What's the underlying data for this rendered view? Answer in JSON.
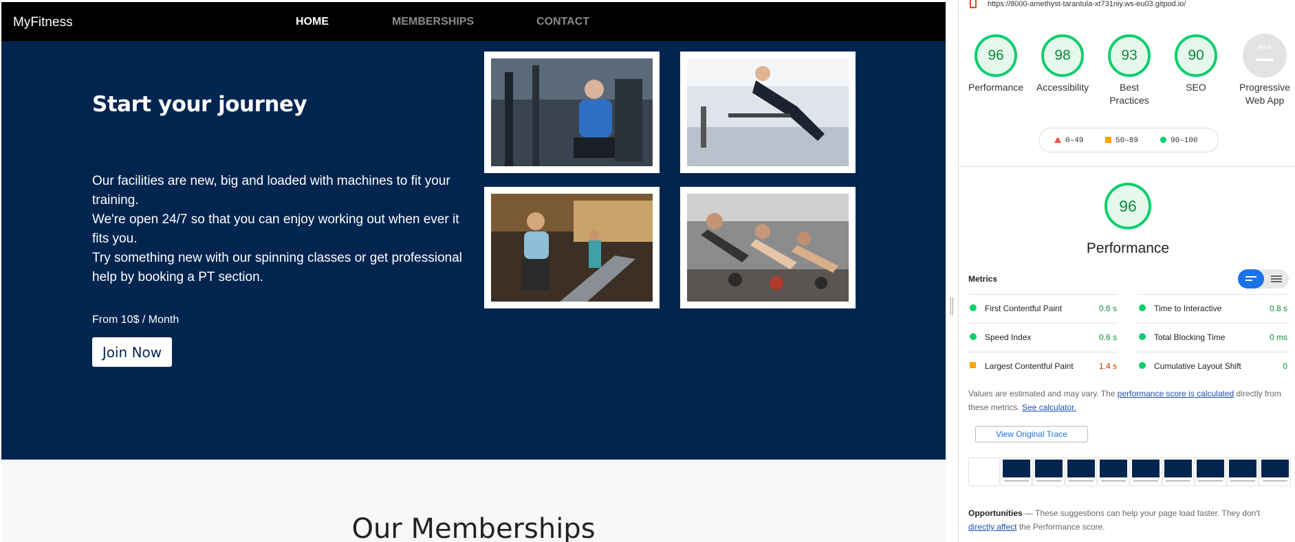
{
  "site": {
    "brand": "MyFitness",
    "nav": [
      {
        "label": "HOME",
        "active": true
      },
      {
        "label": "MEMBERSHIPS",
        "active": false
      },
      {
        "label": "CONTACT",
        "active": false
      }
    ],
    "hero": {
      "title": "Start your journey",
      "paragraph_1": "Our facilities are new, big and loaded with machines to fit your training.",
      "paragraph_2": "We're open 24/7 so that you can enjoy working out when ever it fits you.",
      "paragraph_3": "Try something new with our spinning classes or get professional help by booking a PT section.",
      "price": "From 10$ / Month",
      "cta": "Join Now"
    },
    "photos": [
      "gym-machine-photo",
      "gym-rope-photo",
      "treadmill-photo",
      "kettlebell-class-photo"
    ],
    "memberships_title": "Our Memberships"
  },
  "lighthouse": {
    "url": "https://8000-amethyst-tarantula-xt731niy.ws-eu03.gitpod.io/",
    "scores": [
      {
        "value": "96",
        "label": "Performance"
      },
      {
        "value": "98",
        "label": "Accessibility"
      },
      {
        "value": "93",
        "label": "Best Practices"
      },
      {
        "value": "90",
        "label": "SEO"
      }
    ],
    "pwa": {
      "badge": "PWA",
      "label": "Progressive Web App"
    },
    "legend": [
      "0–49",
      "50–89",
      "90–100"
    ],
    "performance_score": "96",
    "performance_title": "Performance",
    "metrics_label": "Metrics",
    "metrics": [
      {
        "name": "First Contentful Paint",
        "value": "0.6 s",
        "status": "pass"
      },
      {
        "name": "Time to Interactive",
        "value": "0.8 s",
        "status": "pass"
      },
      {
        "name": "Speed Index",
        "value": "0.6 s",
        "status": "pass"
      },
      {
        "name": "Total Blocking Time",
        "value": "0 ms",
        "status": "pass"
      },
      {
        "name": "Largest Contentful Paint",
        "value": "1.4 s",
        "status": "average"
      },
      {
        "name": "Cumulative Layout Shift",
        "value": "0",
        "status": "pass"
      }
    ],
    "note_prefix": "Values are estimated and may vary. The ",
    "note_link": "performance score is calculated",
    "note_middle": " directly from these metrics. ",
    "note_link2": "See calculator.",
    "trace_button": "View Original Trace",
    "opportunities_title": "Opportunities",
    "opportunities_text": " — These suggestions can help your page load faster. They don't ",
    "opportunities_link": "directly affect",
    "opportunities_end": " the Performance score.",
    "colors": {
      "pass": "#0cce6b",
      "average": "#ffa400",
      "fail": "#ff4e42"
    }
  }
}
